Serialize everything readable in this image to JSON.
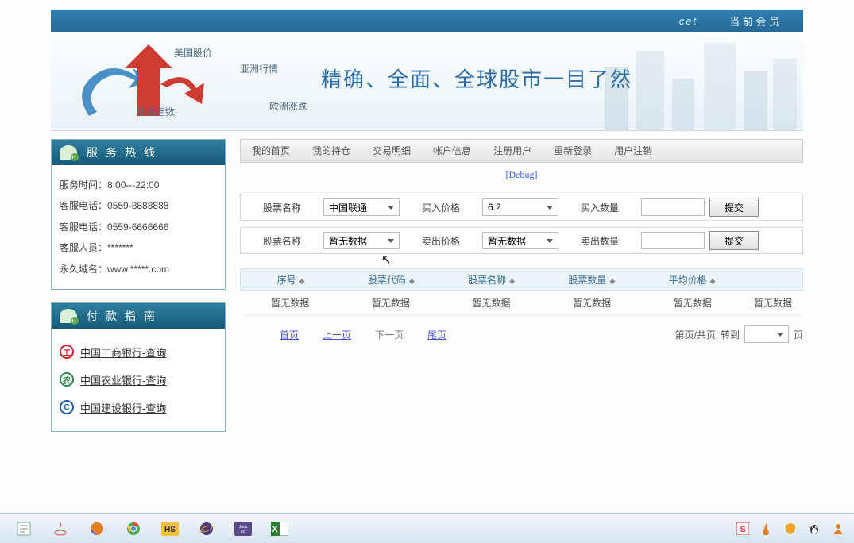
{
  "topbar": {
    "cet": "cet",
    "member": "当 前 会 员"
  },
  "banner": {
    "slogan": "精确、全面、全球股市一目了然",
    "l1": "美国股价",
    "l2": "亚洲行情",
    "l3": "香港指数",
    "l4": "欧洲涨跌"
  },
  "sidebar": {
    "hotline_title": "服务热线",
    "rows": {
      "time_label": "服务时间：",
      "time_val": "8:00---22:00",
      "phone1_label": "客服电话：",
      "phone1_val": "0559-8888888",
      "phone2_label": "客服电话：",
      "phone2_val": "0559-6666666",
      "staff_label": "客服人员：",
      "staff_val": "*******",
      "domain_label": "永久域名：",
      "domain_val": "www.*****.com"
    },
    "payguide_title": "付款指南",
    "banks": {
      "b1": "中国工商银行-查询",
      "b2": "中国农业银行-查询",
      "b3": "中国建设银行-查询"
    }
  },
  "nav": {
    "n1": "我的首页",
    "n2": "我的持仓",
    "n3": "交易明细",
    "n4": "帐户信息",
    "n5": "注册用户",
    "n6": "重新登录",
    "n7": "用户注销"
  },
  "debug": "[Debug]",
  "buy": {
    "name_label": "股票名称",
    "name_val": "中国联通",
    "price_label": "买入价格",
    "price_val": "6.2",
    "qty_label": "买入数量",
    "submit": "提交"
  },
  "sell": {
    "name_label": "股票名称",
    "name_val": "暂无数据",
    "price_label": "卖出价格",
    "price_val": "暂无数据",
    "qty_label": "卖出数量",
    "submit": "提交"
  },
  "table": {
    "h1": "序号",
    "h2": "股票代码",
    "h3": "股票名称",
    "h4": "股票数量",
    "h5": "平均价格",
    "empty": "暂无数据"
  },
  "pager": {
    "first": "首页",
    "prev": "上一页",
    "next": "下一页",
    "last": "尾页",
    "info": "第页/共页",
    "goto": "转到",
    "page_suffix": "页"
  }
}
